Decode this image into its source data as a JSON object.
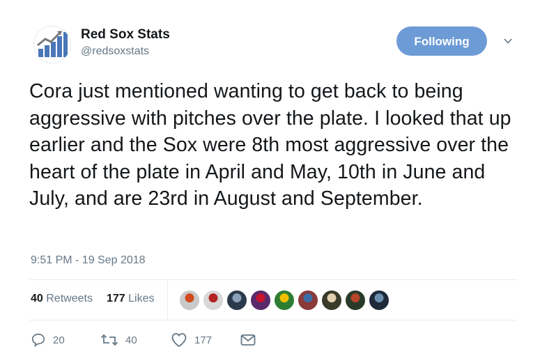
{
  "account": {
    "name": "Red Sox Stats",
    "handle": "@redsoxstats",
    "avatar_icon": "bar-chart-trending-up-icon",
    "follow_label": "Following"
  },
  "tweet": {
    "text": "Cora just mentioned wanting to get back to being aggressive with pitches over the plate. I looked that up earlier and the Sox were 8th most aggressive over the heart of the plate in April and May, 10th in June and July, and are 23rd in August and September.",
    "timestamp": "9:51 PM - 19 Sep 2018"
  },
  "stats": {
    "retweets_count": "40",
    "retweets_label": "Retweets",
    "likes_count": "177",
    "likes_label": "Likes"
  },
  "likers": [
    {
      "color": "#c9c9c9",
      "accent": "#d2491f"
    },
    {
      "color": "#d8d8d8",
      "accent": "#b22222"
    },
    {
      "color": "#2a3a4a",
      "accent": "#8aa0b8"
    },
    {
      "color": "#5a2a6a",
      "accent": "#c8142c"
    },
    {
      "color": "#2e7d32",
      "accent": "#f0c000"
    },
    {
      "color": "#8a3a3a",
      "accent": "#3a6ea5"
    },
    {
      "color": "#3a3a2a",
      "accent": "#e0d0b0"
    },
    {
      "color": "#2a3a2a",
      "accent": "#b8452a"
    },
    {
      "color": "#1e2a3a",
      "accent": "#6c8fb0"
    }
  ],
  "actions": {
    "reply_count": "20",
    "retweet_count": "40",
    "like_count": "177"
  },
  "colors": {
    "follow_button": "#6d9bd6",
    "secondary_text": "#657786",
    "primary_text": "#14171a",
    "divider": "#e6ecf0"
  }
}
